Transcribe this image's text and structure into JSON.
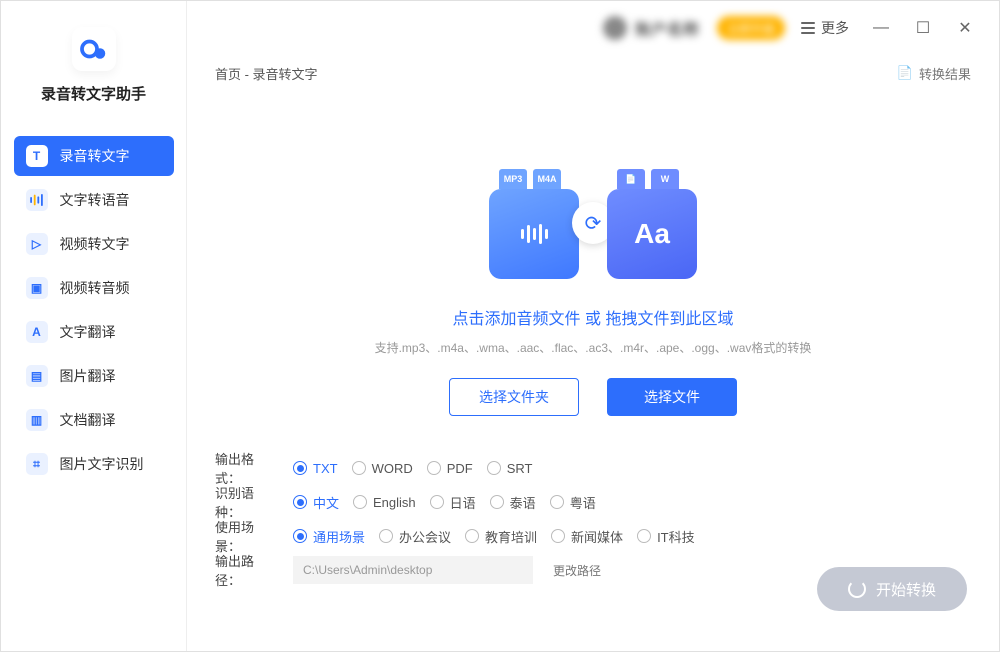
{
  "app": {
    "name": "录音转文字助手"
  },
  "titlebar": {
    "user_name": "账户名称",
    "upgrade": "立即升级",
    "more": "更多"
  },
  "breadcrumb": {
    "text": "首页 - 录音转文字",
    "result": "转换结果"
  },
  "sidebar": {
    "items": [
      {
        "label": "录音转文字",
        "icon": "T",
        "active": true
      },
      {
        "label": "文字转语音",
        "icon": "|||"
      },
      {
        "label": "视频转文字",
        "icon": "▷"
      },
      {
        "label": "视频转音频",
        "icon": "▣"
      },
      {
        "label": "文字翻译",
        "icon": "A"
      },
      {
        "label": "图片翻译",
        "icon": "▤"
      },
      {
        "label": "文档翻译",
        "icon": "▥"
      },
      {
        "label": "图片文字识别",
        "icon": "⌗"
      }
    ]
  },
  "dropzone": {
    "title": "点击添加音频文件 或 拖拽文件到此区域",
    "subtitle": "支持.mp3、.m4a、.wma、.aac、.flac、.ac3、.m4r、.ape、.ogg、.wav格式的转换",
    "choose_folder": "选择文件夹",
    "choose_file": "选择文件",
    "tag_mp3": "MP3",
    "tag_m4a": "M4A",
    "tag_doc": "📄",
    "tag_w": "W",
    "aa": "Aa"
  },
  "options": {
    "format": {
      "label": "输出格式：",
      "items": [
        "TXT",
        "WORD",
        "PDF",
        "SRT"
      ],
      "selected": "TXT"
    },
    "lang": {
      "label": "识别语种：",
      "items": [
        "中文",
        "English",
        "日语",
        "泰语",
        "粤语"
      ],
      "selected": "中文"
    },
    "scene": {
      "label": "使用场景：",
      "items": [
        "通用场景",
        "办公会议",
        "教育培训",
        "新闻媒体",
        "IT科技"
      ],
      "selected": "通用场景"
    },
    "path": {
      "label": "输出路径：",
      "value": "C:\\Users\\Admin\\desktop",
      "change": "更改路径"
    }
  },
  "start": {
    "label": "开始转换"
  }
}
